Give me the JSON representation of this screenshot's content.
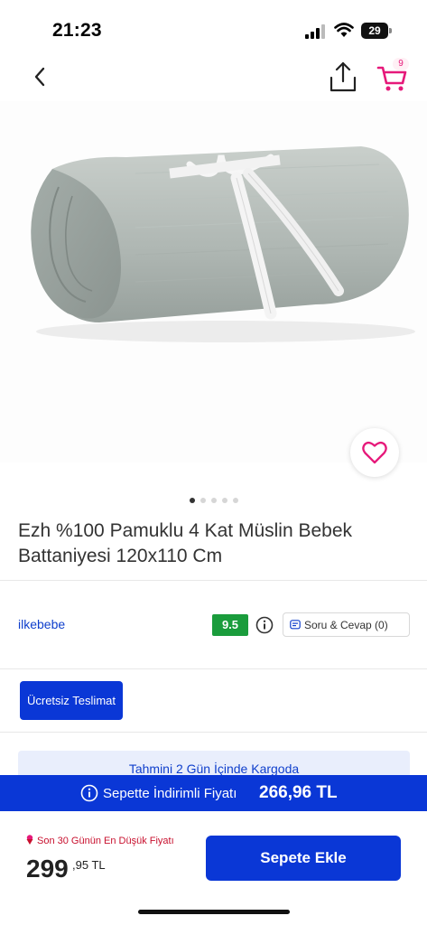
{
  "status_bar": {
    "time": "21:23",
    "battery_level": "29",
    "icons": [
      "cellular-signal-icon",
      "wifi-icon",
      "battery-icon"
    ]
  },
  "nav": {
    "icons": [
      "chevron-left-icon",
      "share-icon",
      "cart-icon"
    ],
    "cart_count": "9",
    "accent_color": "#e6197a"
  },
  "gallery": {
    "image_alt": "Gray muslin blanket rolled and tied with white satin ribbon",
    "image_count": 5,
    "active_index": 0,
    "favorite_icon": "heart-outline-icon"
  },
  "product": {
    "title": "Ezh %100 Pamuklu 4 Kat Müslin Bebek Battaniyesi 120x110 Cm",
    "seller": "ilkebebe",
    "rating": "9.5",
    "qa_label": "Soru & Cevap (0)"
  },
  "shipping": {
    "free_shipping_label": "Ücretsiz Teslimat",
    "estimate_label": "Tahmini 2 Gün İçinde Kargoda"
  },
  "discount_bar": {
    "label": "Sepette İndirimli Fiyatı",
    "price": "266,96 TL"
  },
  "purchase": {
    "lowest_label": "Son 30 Günün En Düşük Fiyatı",
    "price_main": "299",
    "price_cents": ",95 TL",
    "add_to_cart_label": "Sepete Ekle"
  },
  "colors": {
    "brand_blue": "#0a37d6",
    "rating_green": "#1a9c3c",
    "alert_red": "#c8102e"
  }
}
